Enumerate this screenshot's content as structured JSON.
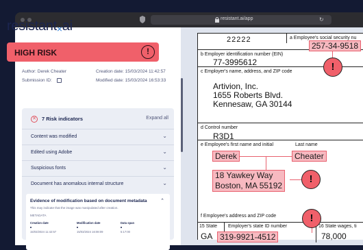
{
  "browser": {
    "url": "resistant.ai/app",
    "reload_icon": "reload-icon"
  },
  "sidebar": {
    "logo_pre": "resistant",
    "logo_x": "×",
    "logo_post": "ai",
    "risk_label": "HIGH RISK",
    "risk_icon": "!",
    "author": "Author: Derek Cheater",
    "submission": "Submission ID:",
    "creation": "Creation date: 15/03/2024 11:42:57",
    "modified": "Modified date: 15/03/2024 16:53:33",
    "indicators_title": "7 Risk indicators",
    "expand_all": "Expand all",
    "indicators": [
      "Content was modified",
      "Edited using Adobe",
      "Suspicious fonts",
      "Document has anomalous internal structure"
    ],
    "evidence": {
      "title": "Evidence of modification based on document metadata",
      "desc": "This may indicate that the image was manipulated after creation.",
      "metadata": "METADATA",
      "cols": [
        "Creation date",
        "Modification date",
        "Data span"
      ],
      "vals": [
        "15/03/2024 11:42:57",
        "15/03/2024 16:08:09",
        "5:17:00"
      ]
    },
    "colors": {
      "risk": "#f0606a",
      "brand": "#1b2550",
      "accent": "#2f7fd8"
    }
  },
  "form": {
    "box_top_value": "22222",
    "a_label": "a  Employee's social security nu",
    "ssn": "257-34-9518",
    "b_label": "b  Employer identification number (EIN)",
    "ein": "77-3995612",
    "c_label": "c  Employer's name, address, and ZIP code",
    "employer_lines": [
      "Artivion, Inc.",
      "1655 Roberts Blvd.",
      "Kennesaw, GA 30144"
    ],
    "d_label": "d  Control number",
    "control": "R3D1",
    "e_label": "e  Employee's first name and initial",
    "last_name_label": "Last name",
    "first_name": "Derek",
    "last_name": "Cheater",
    "addr1": "18 Yawkey Way",
    "addr2": "Boston, MA 55192",
    "f_label": "f  Employee's address and ZIP code",
    "state_label": "15 State",
    "state_id_label": "Employer's state ID number",
    "wages_label": "16  State wages, ti",
    "state": "GA",
    "state_id": "319-9921-4512",
    "wages": "78,000",
    "alert_icon": "!"
  }
}
